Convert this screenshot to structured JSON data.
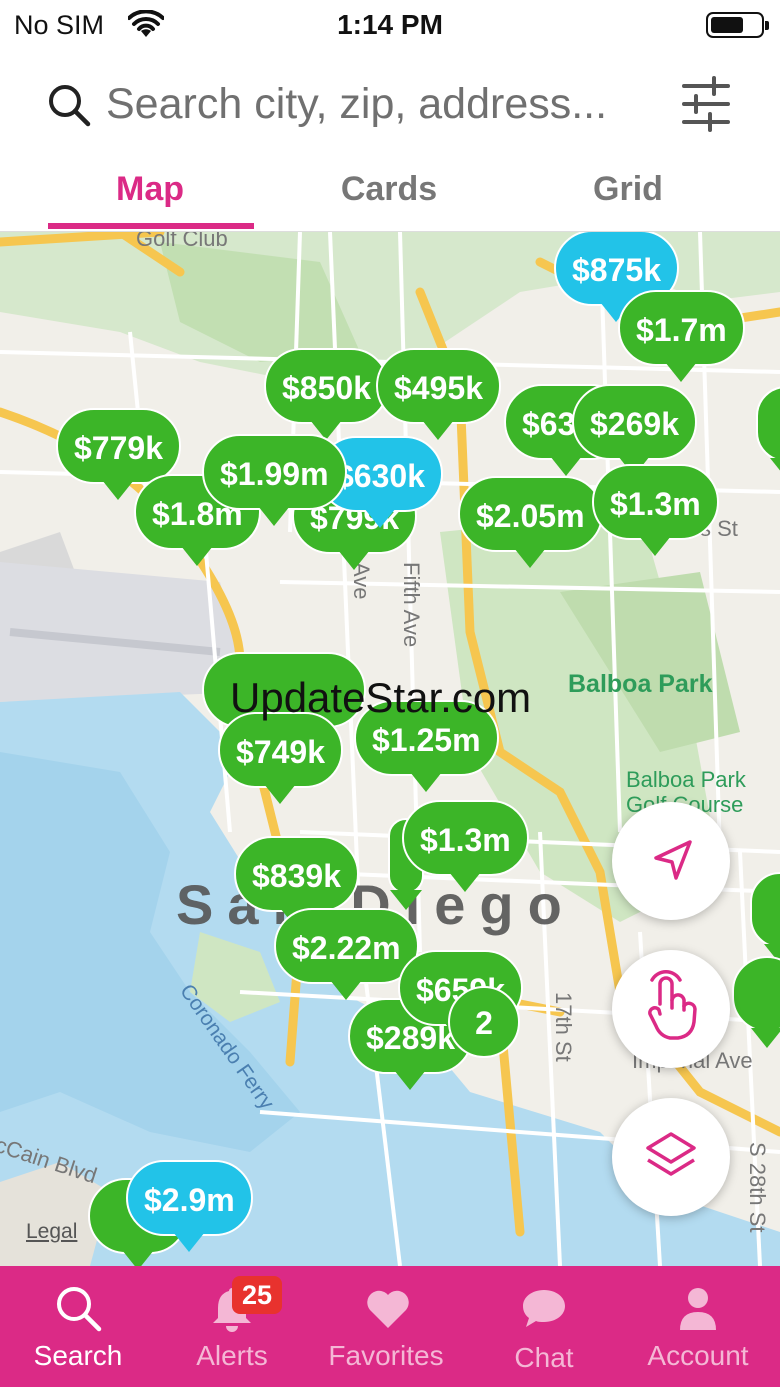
{
  "status_bar": {
    "carrier": "No SIM",
    "time": "1:14 PM"
  },
  "search": {
    "placeholder": "Search city, zip, address..."
  },
  "tabs": [
    {
      "label": "Map",
      "active": true
    },
    {
      "label": "Cards",
      "active": false
    },
    {
      "label": "Grid",
      "active": false
    }
  ],
  "map": {
    "labels": {
      "golf_club": "Golf Club",
      "balboa_park": "Balboa Park",
      "balboa_golf_1": "Balboa Park",
      "balboa_golf_2": "Golf Course",
      "city": "San Diego",
      "fifth_ave": "Fifth Ave",
      "ave": "Ave",
      "coronado_ferry": "Coronado Ferry",
      "mccain_blvd": "cCain Blvd",
      "imperial_ave": "Imperial Ave",
      "s_st": "s St",
      "st17": "17th St",
      "s28th": "S 28th St",
      "legal": "Legal"
    },
    "pins": [
      {
        "label": "$875k",
        "color": "blue"
      },
      {
        "label": "$1.7m",
        "color": "green"
      },
      {
        "label": "$850k",
        "color": "green"
      },
      {
        "label": "$495k",
        "color": "green"
      },
      {
        "label": "$635k",
        "color": "green"
      },
      {
        "label": "$269k",
        "color": "green"
      },
      {
        "label": "$779k",
        "color": "green"
      },
      {
        "label": "$1.8m",
        "color": "green"
      },
      {
        "label": "$799k",
        "color": "green"
      },
      {
        "label": "$630k",
        "color": "blue"
      },
      {
        "label": "$1.99m",
        "color": "green"
      },
      {
        "label": "$2.05m",
        "color": "green"
      },
      {
        "label": "$1.3m",
        "color": "green"
      },
      {
        "label": "$1.25m",
        "color": "green"
      },
      {
        "label": "$749k",
        "color": "green"
      },
      {
        "label": "$1.3m",
        "color": "green"
      },
      {
        "label": "$839k",
        "color": "green"
      },
      {
        "label": "$2.22m",
        "color": "green"
      },
      {
        "label": "$659k",
        "color": "green"
      },
      {
        "label": "$289k",
        "color": "green"
      },
      {
        "label": "2",
        "color": "green"
      },
      {
        "label": "$2.9m",
        "color": "blue"
      }
    ],
    "watermark": "UpdateStar.com"
  },
  "bottom_nav": {
    "items": [
      {
        "label": "Search",
        "icon": "search-icon",
        "active": true
      },
      {
        "label": "Alerts",
        "icon": "bell-icon",
        "active": false
      },
      {
        "label": "Favorites",
        "icon": "heart-icon",
        "active": false
      },
      {
        "label": "Chat",
        "icon": "chat-bubble-icon",
        "active": false
      },
      {
        "label": "Account",
        "icon": "person-icon",
        "active": false
      }
    ],
    "alerts_badge": "25"
  },
  "colors": {
    "accent": "#db2a86",
    "pin_green": "#3cb528",
    "pin_blue": "#22c3e8",
    "badge_red": "#e8322e"
  }
}
